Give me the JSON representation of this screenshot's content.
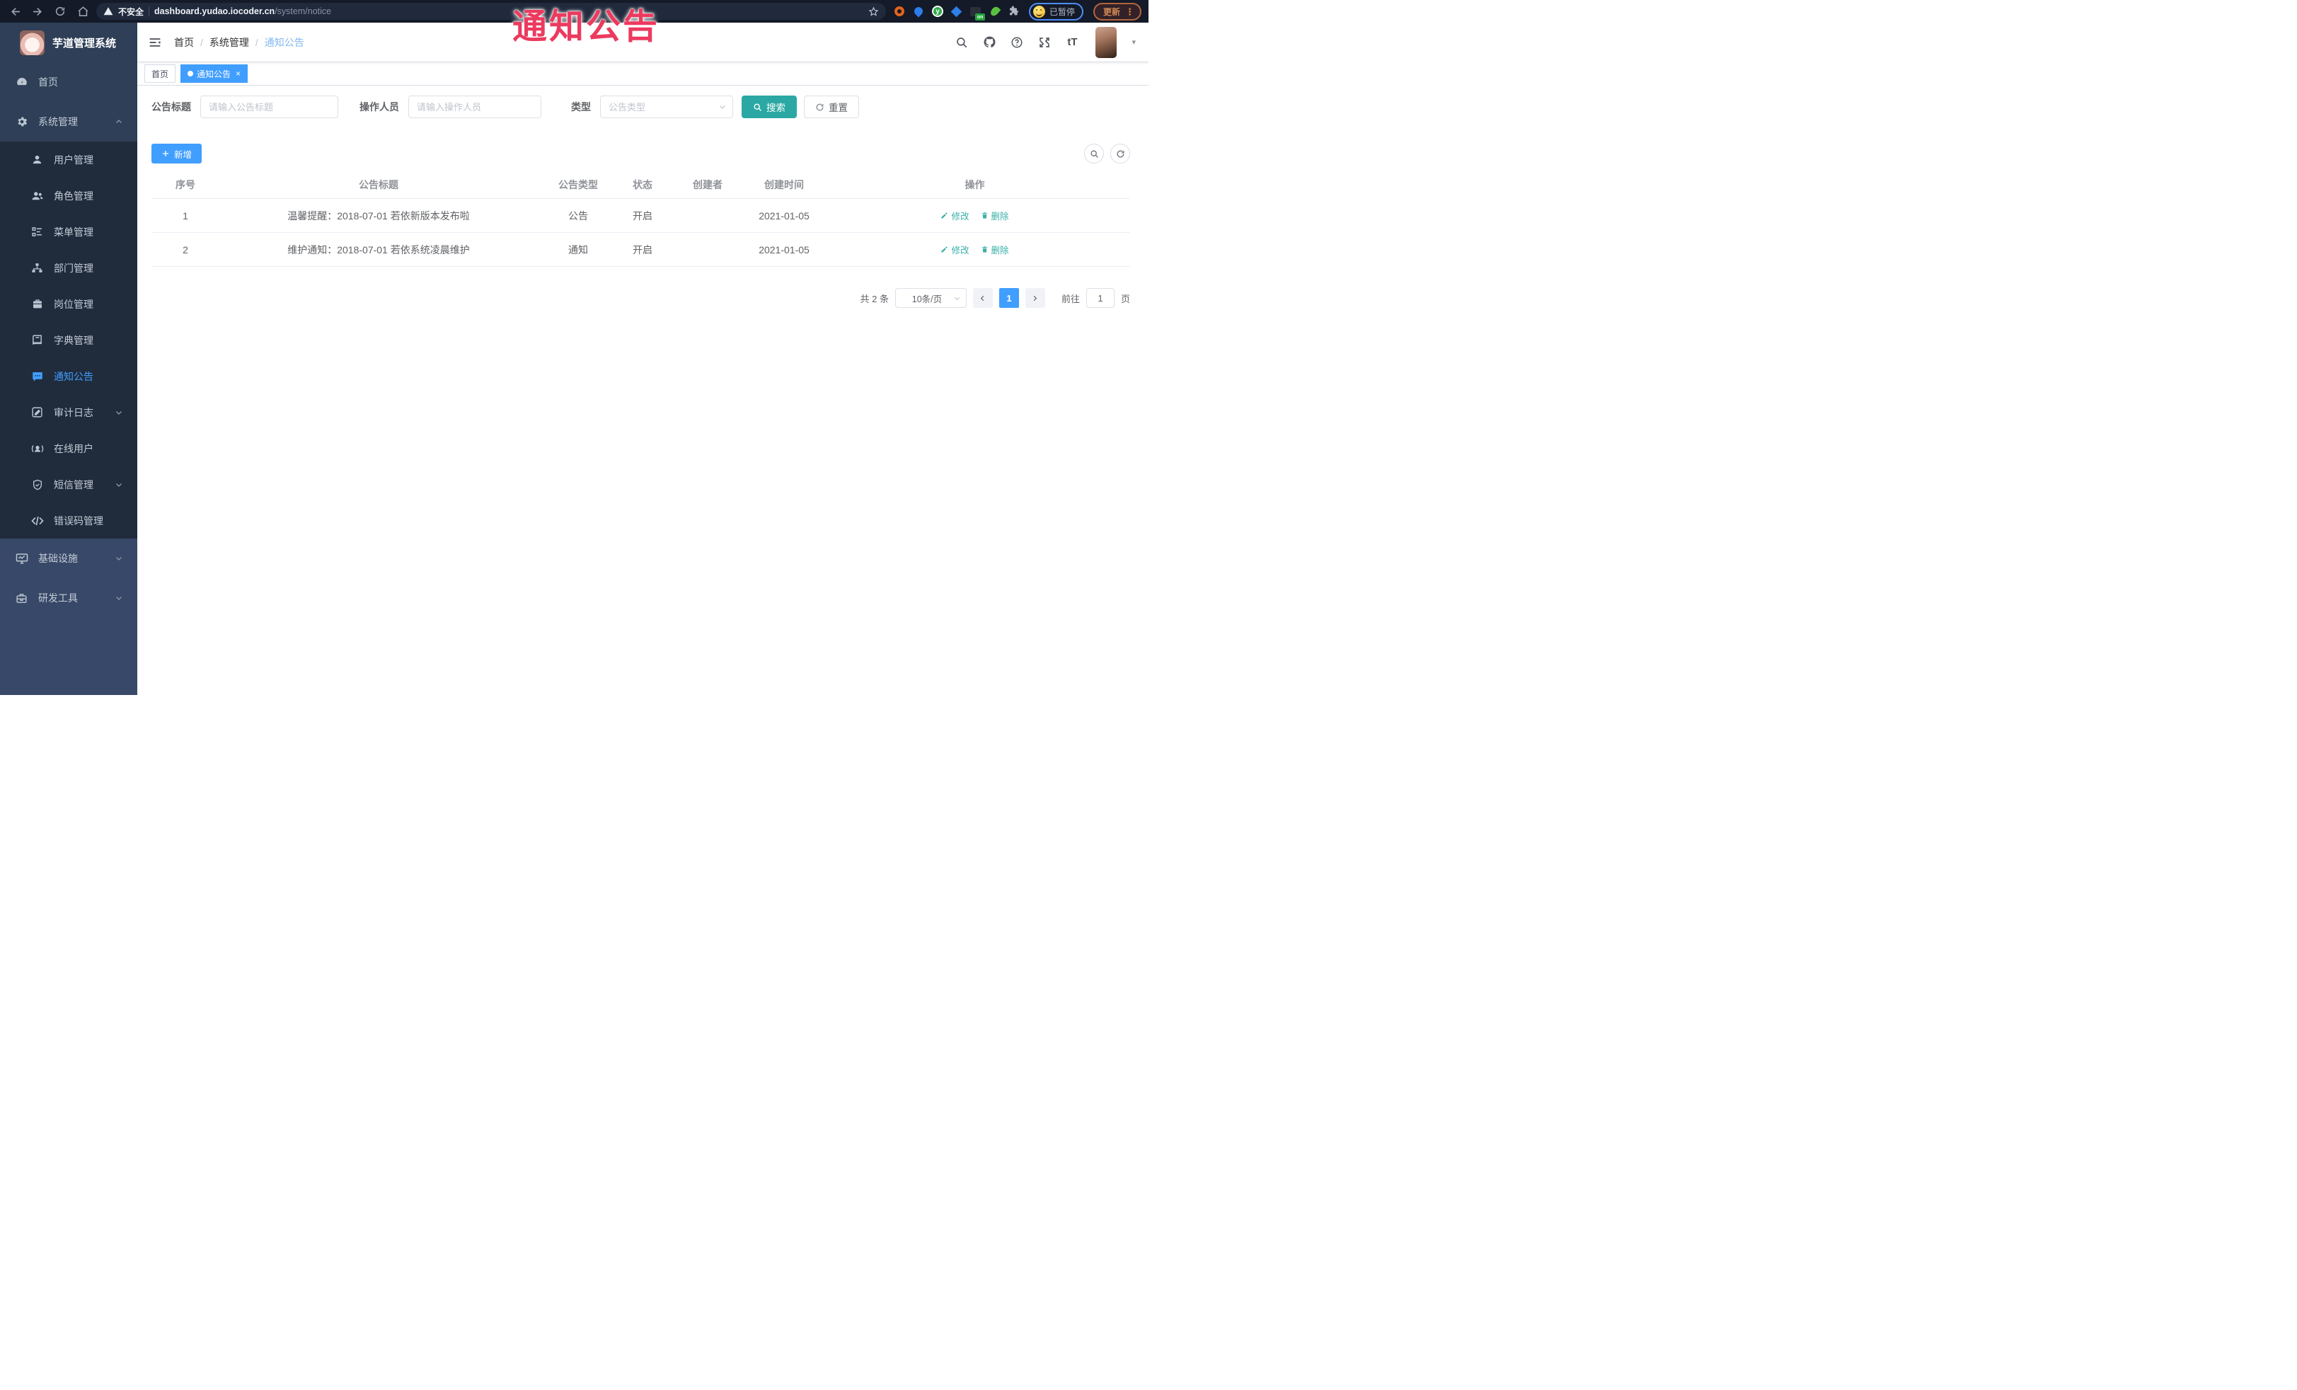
{
  "browser": {
    "security_label": "不安全",
    "url_host": "dashboard.yudao.iocoder.cn",
    "url_path": "/system/notice",
    "extension_badge": "on",
    "profile_status": "已暂停",
    "update_button": "更新"
  },
  "overlay": {
    "title": "通知公告"
  },
  "sidebar": {
    "app_title": "芋道管理系统",
    "items": [
      {
        "label": "首页",
        "icon": "dashboard-icon",
        "level": "top"
      },
      {
        "label": "系统管理",
        "icon": "gear-icon",
        "level": "top",
        "expanded": true
      },
      {
        "label": "用户管理",
        "icon": "user-icon",
        "level": "sub"
      },
      {
        "label": "角色管理",
        "icon": "users-icon",
        "level": "sub"
      },
      {
        "label": "菜单管理",
        "icon": "menu-tree-icon",
        "level": "sub"
      },
      {
        "label": "部门管理",
        "icon": "org-tree-icon",
        "level": "sub"
      },
      {
        "label": "岗位管理",
        "icon": "post-icon",
        "level": "sub"
      },
      {
        "label": "字典管理",
        "icon": "dict-icon",
        "level": "sub"
      },
      {
        "label": "通知公告",
        "icon": "message-icon",
        "level": "sub",
        "active": true
      },
      {
        "label": "审计日志",
        "icon": "log-icon",
        "level": "sub",
        "collapsible": true
      },
      {
        "label": "在线用户",
        "icon": "online-user-icon",
        "level": "sub"
      },
      {
        "label": "短信管理",
        "icon": "shield-icon",
        "level": "sub",
        "collapsible": true
      },
      {
        "label": "错误码管理",
        "icon": "code-icon",
        "level": "sub"
      },
      {
        "label": "基础设施",
        "icon": "monitor-icon",
        "level": "top",
        "collapsible": true
      },
      {
        "label": "研发工具",
        "icon": "toolbox-icon",
        "level": "top",
        "collapsible": true
      }
    ]
  },
  "navbar": {
    "breadcrumb": {
      "0": "首页",
      "1": "系统管理",
      "2": "通知公告"
    },
    "separator": "/"
  },
  "tabs": [
    {
      "label": "首页",
      "active": false
    },
    {
      "label": "通知公告",
      "active": true
    }
  ],
  "icons": {
    "font_size_glyph": "tT",
    "kebab": "⋮",
    "caret_down": "▾",
    "tag_close": "×",
    "puzzle": "⚩"
  },
  "search_form": {
    "title_label": "公告标题",
    "title_placeholder": "请输入公告标题",
    "operator_label": "操作人员",
    "operator_placeholder": "请输入操作人员",
    "type_label": "类型",
    "type_placeholder": "公告类型",
    "search_button": "搜索",
    "reset_button": "重置"
  },
  "toolbar": {
    "add_button": "新增"
  },
  "table": {
    "headers": [
      "序号",
      "公告标题",
      "公告类型",
      "状态",
      "创建者",
      "创建时间",
      "操作"
    ],
    "rows": [
      {
        "index": "1",
        "title": "温馨提醒：2018-07-01 若依新版本发布啦",
        "type": "公告",
        "status": "开启",
        "creator": "",
        "created_at": "2021-01-05",
        "edit": "修改",
        "delete": "删除"
      },
      {
        "index": "2",
        "title": "维护通知：2018-07-01 若依系统凌晨维护",
        "type": "通知",
        "status": "开启",
        "creator": "",
        "created_at": "2021-01-05",
        "edit": "修改",
        "delete": "删除"
      }
    ]
  },
  "pagination": {
    "total": "共 2 条",
    "page_size": "10条/页",
    "current_page": "1",
    "goto_label": "前往",
    "goto_value": "1",
    "goto_suffix": "页"
  },
  "colors": {
    "primary": "#409eff",
    "cyan": "#2ba8a3",
    "sidebar_bg": "#31415c",
    "submenu_bg": "#202c3c",
    "annotation_red": "#ec3a5f"
  }
}
